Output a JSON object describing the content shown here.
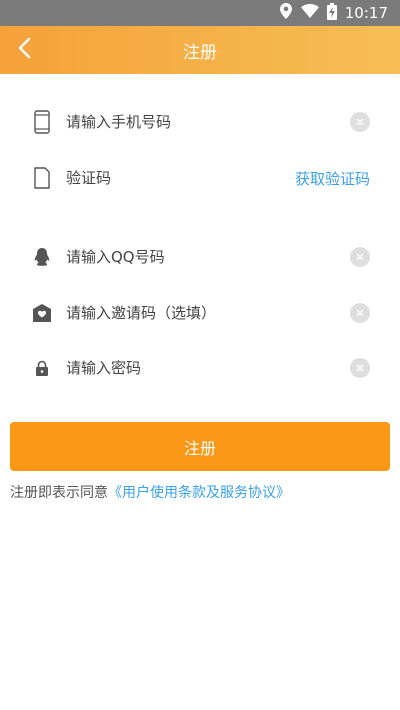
{
  "status_bar": {
    "time": "10:17",
    "icons": [
      "location-icon",
      "wifi-icon",
      "battery-charging-icon"
    ]
  },
  "app_bar": {
    "title": "注册",
    "back_icon": "chevron-left-icon"
  },
  "form": {
    "phone": {
      "placeholder": "请输入手机号码",
      "icon": "phone-icon",
      "value": ""
    },
    "code": {
      "placeholder": "验证码",
      "icon": "sms-card-icon",
      "value": "",
      "get_code_label": "获取验证码"
    },
    "qq": {
      "placeholder": "请输入QQ号码",
      "icon": "qq-penguin-icon",
      "value": ""
    },
    "invite": {
      "placeholder": "请输入邀请码（选填）",
      "icon": "gift-envelope-icon",
      "value": ""
    },
    "password": {
      "placeholder": "请输入密码",
      "icon": "lock-icon",
      "value": ""
    }
  },
  "submit_label": "注册",
  "agreement": {
    "prefix": "注册即表示同意",
    "link_text": "《用户使用条款及服务协议》"
  },
  "colors": {
    "accent": "#fb9817",
    "link": "#3aa0e8",
    "header_start": "#f5a13a",
    "header_end": "#f7be56"
  }
}
